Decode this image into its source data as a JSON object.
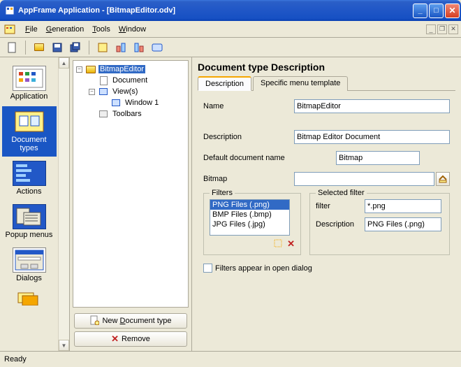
{
  "window": {
    "title": "AppFrame Application - [BitmapEditor.odv]"
  },
  "menubar": {
    "file": "File",
    "generation": "Generation",
    "tools": "Tools",
    "window": "Window"
  },
  "leftrail": {
    "items": [
      {
        "label": "Application"
      },
      {
        "label": "Document types"
      },
      {
        "label": "Actions"
      },
      {
        "label": "Popup menus"
      },
      {
        "label": "Dialogs"
      }
    ]
  },
  "tree": {
    "root": "BitmapEditor",
    "document": "Document",
    "views": "View(s)",
    "window1": "Window 1",
    "toolbars": "Toolbars"
  },
  "buttons": {
    "new_doc_type": "ocument type",
    "new_prefix": "New D",
    "remove": "Remove"
  },
  "right": {
    "title": "Document type Description",
    "tabs": {
      "description": "Description",
      "specific": "Specific menu template"
    },
    "labels": {
      "name": "Name",
      "description": "Description",
      "default_doc_name": "Default document name",
      "bitmap": "Bitmap",
      "filters": "Filters",
      "selected_filter": "Selected filter",
      "filter": "filter",
      "filter_description": "Description",
      "filters_appear": "Filters appear in open dialog"
    },
    "values": {
      "name": "BitmapEditor",
      "description": "Bitmap Editor Document",
      "default_doc_name": "Bitmap",
      "bitmap": "",
      "filter_pattern": "*.png",
      "filter_description": "PNG Files (.png)"
    },
    "filters": [
      "PNG Files (.png)",
      "BMP Files (.bmp)",
      "JPG Files (.jpg)"
    ]
  },
  "statusbar": {
    "text": "Ready"
  }
}
